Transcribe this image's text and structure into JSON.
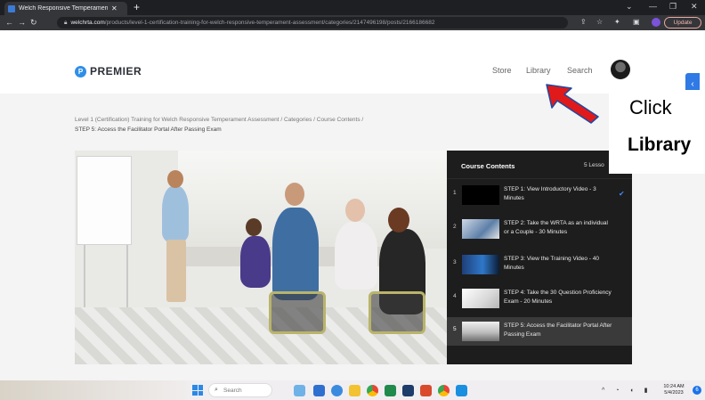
{
  "browser": {
    "tab_title": "Welch Responsive Temperament",
    "url_host": "welchrta.com",
    "url_path": "/products/level-1-certification-training-for-welch-responsive-temperament-assessment/categories/2147496198/posts/2166186682",
    "update_label": "Update"
  },
  "site": {
    "logo_text": "PREMIER",
    "logo_mark": "P",
    "nav": [
      "Store",
      "Library",
      "Search"
    ]
  },
  "breadcrumb": {
    "path": "Level 1 (Certification) Training for Welch Responsive Temperament Assessment / Categories / Course Contents /",
    "current": "STEP 5: Access the Facilitator Portal After Passing Exam"
  },
  "course": {
    "title": "Course Contents",
    "count_label": "5 Lesso",
    "lessons": [
      {
        "num": "1",
        "title": "STEP 1: View Introductory Video - 3 Minutes",
        "completed": true
      },
      {
        "num": "2",
        "title": "STEP 2: Take the WRTA as an individual or a Couple - 30 Minutes",
        "completed": false
      },
      {
        "num": "3",
        "title": "STEP 3: View the Training Video - 40 Minutes",
        "completed": false
      },
      {
        "num": "4",
        "title": "STEP 4: Take the 30 Question Proficiency Exam - 20 Minutes",
        "completed": false
      },
      {
        "num": "5",
        "title": "STEP 5: Access the Facilitator Portal After Passing Exam",
        "completed": false
      }
    ],
    "active_lesson": 5,
    "check_glyph": "✔"
  },
  "callout": {
    "line1": "Click",
    "line2": "Library"
  },
  "taskbar": {
    "search_placeholder": "Search",
    "time": "10:24 AM",
    "date": "5/4/2023",
    "notification_count": "6"
  },
  "colors": {
    "accent": "#2f8fe6",
    "panel_bg": "#1d1d1d",
    "arrow": "#e01a1a",
    "check": "#3d8df2"
  },
  "icons": {
    "back": "arrow-left-icon",
    "forward": "arrow-right-icon",
    "reload": "reload-icon",
    "lock": "lock-icon",
    "share": "share-icon",
    "bookmark": "star-icon",
    "extensions": "puzzle-icon",
    "sidepanel": "sidepanel-icon"
  }
}
